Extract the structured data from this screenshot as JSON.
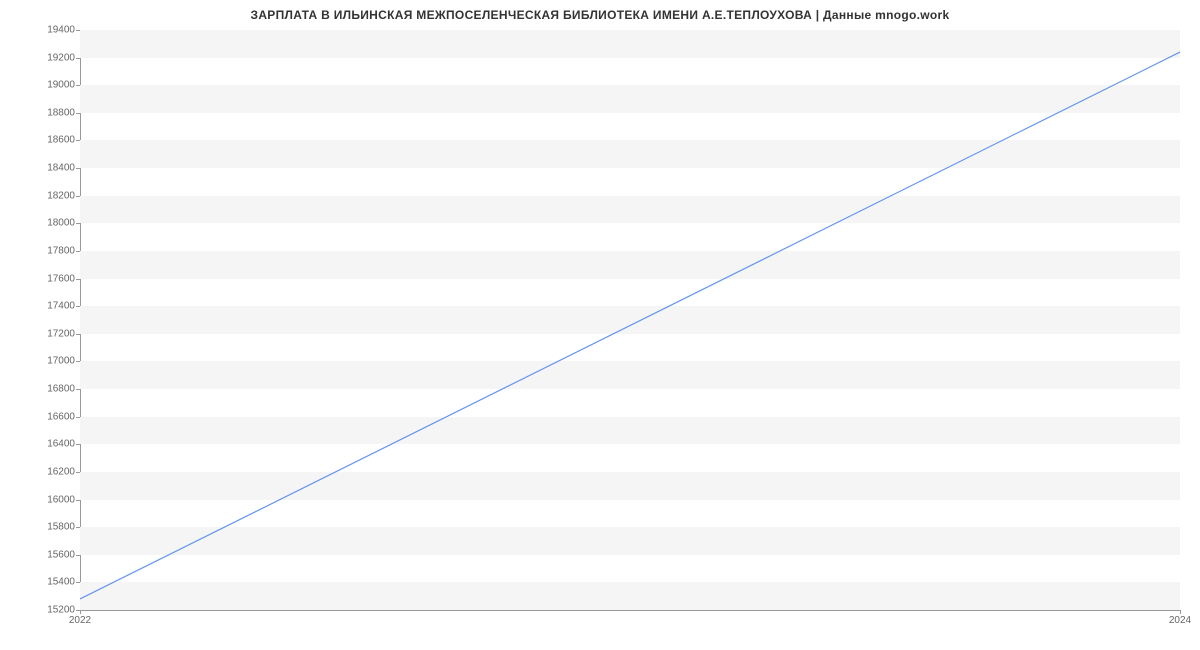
{
  "chart_data": {
    "type": "line",
    "title": "ЗАРПЛАТА В ИЛЬИНСКАЯ МЕЖПОСЕЛЕНЧЕСКАЯ БИБЛИОТЕКА ИМЕНИ А.Е.ТЕПЛОУХОВА | Данные mnogo.work",
    "x": [
      2022,
      2024
    ],
    "values": [
      15280,
      19240
    ],
    "xlabel": "",
    "ylabel": "",
    "xlim": [
      2022,
      2024
    ],
    "ylim": [
      15200,
      19400
    ],
    "y_ticks": [
      15200,
      15400,
      15600,
      15800,
      16000,
      16200,
      16400,
      16600,
      16800,
      17000,
      17200,
      17400,
      17600,
      17800,
      18000,
      18200,
      18400,
      18600,
      18800,
      19000,
      19200,
      19400
    ],
    "x_ticks": [
      2022,
      2024
    ],
    "line_color": "#6495ED"
  }
}
